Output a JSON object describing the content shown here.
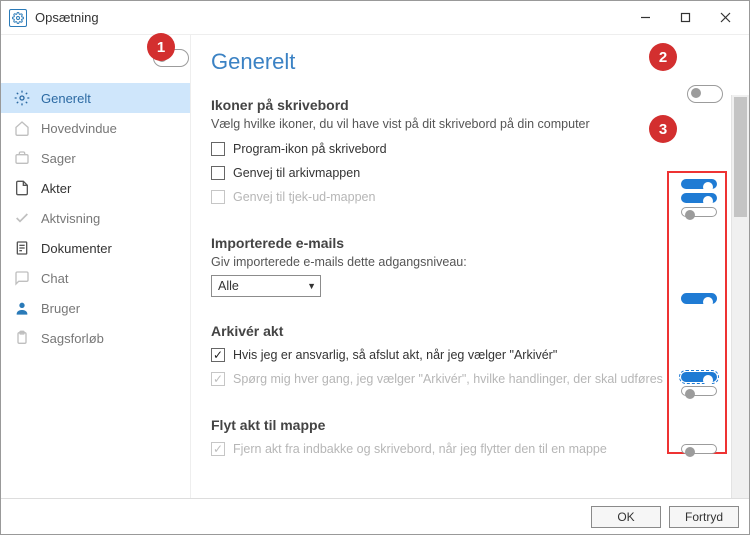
{
  "window": {
    "title": "Opsætning"
  },
  "markers": {
    "m1": "1",
    "m2": "2",
    "m3": "3"
  },
  "sidebar": {
    "items": [
      {
        "label": "Generelt"
      },
      {
        "label": "Hovedvindue"
      },
      {
        "label": "Sager"
      },
      {
        "label": "Akter"
      },
      {
        "label": "Aktvisning"
      },
      {
        "label": "Dokumenter"
      },
      {
        "label": "Chat"
      },
      {
        "label": "Bruger"
      },
      {
        "label": "Sagsforløb"
      }
    ]
  },
  "main": {
    "title": "Generelt",
    "icons_section": {
      "heading": "Ikoner på skrivebord",
      "desc": "Vælg hvilke ikoner, du vil have vist på dit skrivebord på din computer",
      "opt1": "Program-ikon på skrivebord",
      "opt2": "Genvej til arkivmappen",
      "opt3": "Genvej til tjek-ud-mappen"
    },
    "emails_section": {
      "heading": "Importerede e-mails",
      "desc": "Giv importerede e-mails dette adgangsniveau:",
      "select_value": "Alle"
    },
    "archive_section": {
      "heading": "Arkivér akt",
      "opt1": "Hvis jeg er ansvarlig, så afslut akt, når jeg vælger \"Arkivér\"",
      "opt2": "Spørg mig hver gang, jeg vælger \"Arkivér\", hvilke handlinger, der skal udføres"
    },
    "move_section": {
      "heading": "Flyt akt til mappe",
      "opt1": "Fjern akt fra indbakke og skrivebord, når jeg flytter den til en mappe"
    }
  },
  "footer": {
    "ok": "OK",
    "cancel": "Fortryd"
  }
}
